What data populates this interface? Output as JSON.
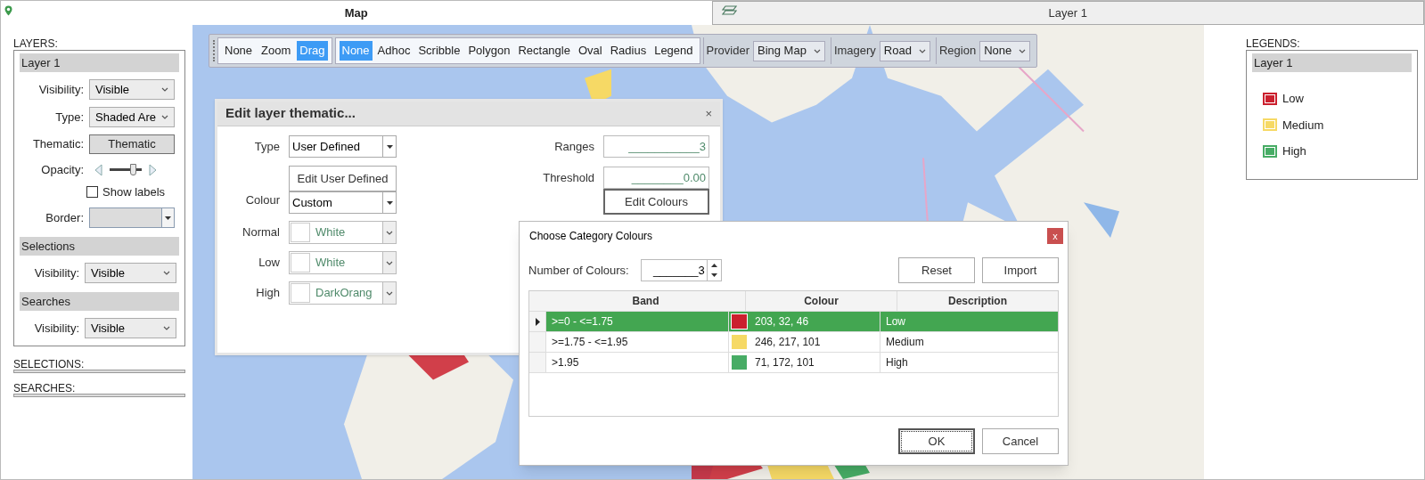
{
  "tabs": [
    {
      "label": "Map",
      "selected": true
    },
    {
      "label": "Layer 1",
      "selected": false
    }
  ],
  "left_panel": {
    "layers_heading": "LAYERS:",
    "layer": {
      "title": "Layer 1",
      "visibility_label": "Visibility:",
      "visibility": "Visible",
      "type_label": "Type:",
      "type": "Shaded Are",
      "thematic_label": "Thematic:",
      "thematic_button": "Thematic",
      "opacity_label": "Opacity:",
      "opacity": {
        "level": 0.75
      },
      "show_labels": {
        "label": "Show labels",
        "checked": false
      },
      "border_label": "Border:"
    },
    "selections": {
      "title": "Selections",
      "visibility_label": "Visibility:",
      "visibility": "Visible"
    },
    "searches": {
      "title": "Searches",
      "visibility_label": "Visibility:",
      "visibility": "Visible"
    },
    "selections_heading": "SELECTIONS:",
    "searches_heading": "SEARCHES:"
  },
  "toolbar": {
    "navigation": [
      {
        "label": "None",
        "selected": false
      },
      {
        "label": "Zoom",
        "selected": false
      },
      {
        "label": "Drag",
        "selected": true
      }
    ],
    "tools": [
      {
        "label": "None",
        "selected": true
      },
      {
        "label": "Adhoc",
        "selected": false
      },
      {
        "label": "Scribble",
        "selected": false
      },
      {
        "label": "Polygon",
        "selected": false
      },
      {
        "label": "Rectangle",
        "selected": false
      },
      {
        "label": "Oval",
        "selected": false
      },
      {
        "label": "Radius",
        "selected": false
      },
      {
        "label": "Legend",
        "selected": false
      }
    ],
    "dropdowns": [
      {
        "label": "Provider",
        "value": "Bing Map"
      },
      {
        "label": "Imagery",
        "value": "Road"
      },
      {
        "label": "Region",
        "value": "None"
      }
    ]
  },
  "thematic_dialog": {
    "title": "Edit layer thematic...",
    "close": "×",
    "type_label": "Type",
    "type": "User Defined",
    "edit_button": "Edit User Defined",
    "colour_label": "Colour",
    "colour": "Custom",
    "swatches": [
      {
        "label": "Normal",
        "value": "White"
      },
      {
        "label": "Low",
        "value": "White"
      },
      {
        "label": "High",
        "value": "DarkOrang"
      }
    ],
    "ranges_label": "Ranges",
    "ranges": "___________3",
    "threshold_label": "Threshold",
    "threshold": "________0.00",
    "edit_colours_button": "Edit Colours"
  },
  "colours_dialog": {
    "title": "Choose Category Colours",
    "close": "x",
    "count_label": "Number of Colours:",
    "count": "_______3",
    "reset_button": "Reset",
    "import_button": "Import",
    "table": {
      "columns": [
        "Band",
        "Colour",
        "Description"
      ],
      "rows": [
        {
          "band": ">=0 - <=1.75",
          "color": "#cb202e",
          "colour": "203, 32, 46",
          "description": "Low",
          "selected": true
        },
        {
          "band": ">=1.75 - <=1.95",
          "color": "#f6d965",
          "colour": "246, 217, 101",
          "description": "Medium",
          "selected": false
        },
        {
          "band": ">1.95",
          "color": "#47ac65",
          "colour": "71, 172, 101",
          "description": "High",
          "selected": false
        }
      ]
    },
    "ok_button": "OK",
    "cancel_button": "Cancel"
  },
  "legends": {
    "heading": "LEGENDS:",
    "title": "Layer 1",
    "items": [
      {
        "label": "Low",
        "color": "#cb202e"
      },
      {
        "label": "Medium",
        "color": "#f6d965"
      },
      {
        "label": "High",
        "color": "#47ac65"
      }
    ]
  }
}
